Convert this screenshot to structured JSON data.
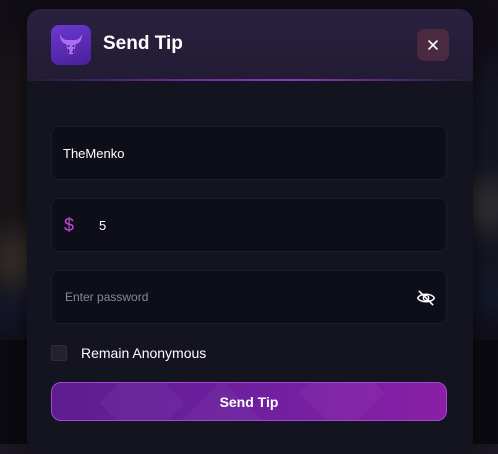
{
  "modal": {
    "title": "Send Tip",
    "logo_icon": "bull-logo-icon",
    "close_icon": "close-icon"
  },
  "form": {
    "username_value": "TheMenko",
    "amount_currency_symbol": "$",
    "amount_value": "5",
    "password_placeholder": "Enter password",
    "password_toggle_icon": "eye-off-icon",
    "anonymous_label": "Remain Anonymous",
    "anonymous_checked": false,
    "submit_label": "Send Tip"
  },
  "colors": {
    "accent": "#8a1fa5",
    "dollar": "#c04ad8",
    "background": "#141320"
  }
}
